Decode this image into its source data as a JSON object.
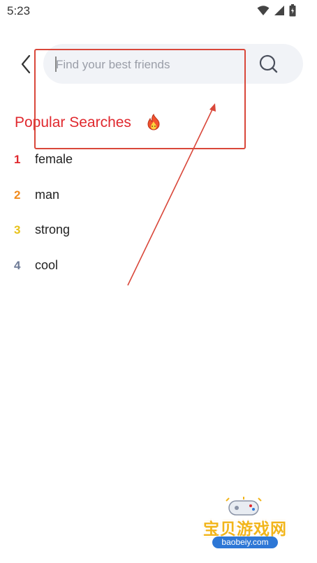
{
  "status_bar": {
    "time": "5:23",
    "icons": [
      "wifi-icon",
      "signal-icon",
      "battery-icon"
    ]
  },
  "header": {
    "back_icon": "chevron-left-icon",
    "search": {
      "placeholder": "Find your best friends",
      "value": ""
    },
    "search_icon": "search-icon"
  },
  "popular": {
    "title": "Popular Searches",
    "title_icon": "fire-icon",
    "items": [
      {
        "rank": "1",
        "label": "female",
        "color": "#e0282e"
      },
      {
        "rank": "2",
        "label": "man",
        "color": "#f08a1c"
      },
      {
        "rank": "3",
        "label": "strong",
        "color": "#e8c21a"
      },
      {
        "rank": "4",
        "label": "cool",
        "color": "#6d7a96"
      }
    ]
  },
  "watermark": {
    "logo_text": "宝贝游戏网",
    "url": "baobeiy.com"
  },
  "colors": {
    "accent": "#e0282e",
    "search_bg": "#f1f3f7",
    "annotation": "#d9473a"
  }
}
